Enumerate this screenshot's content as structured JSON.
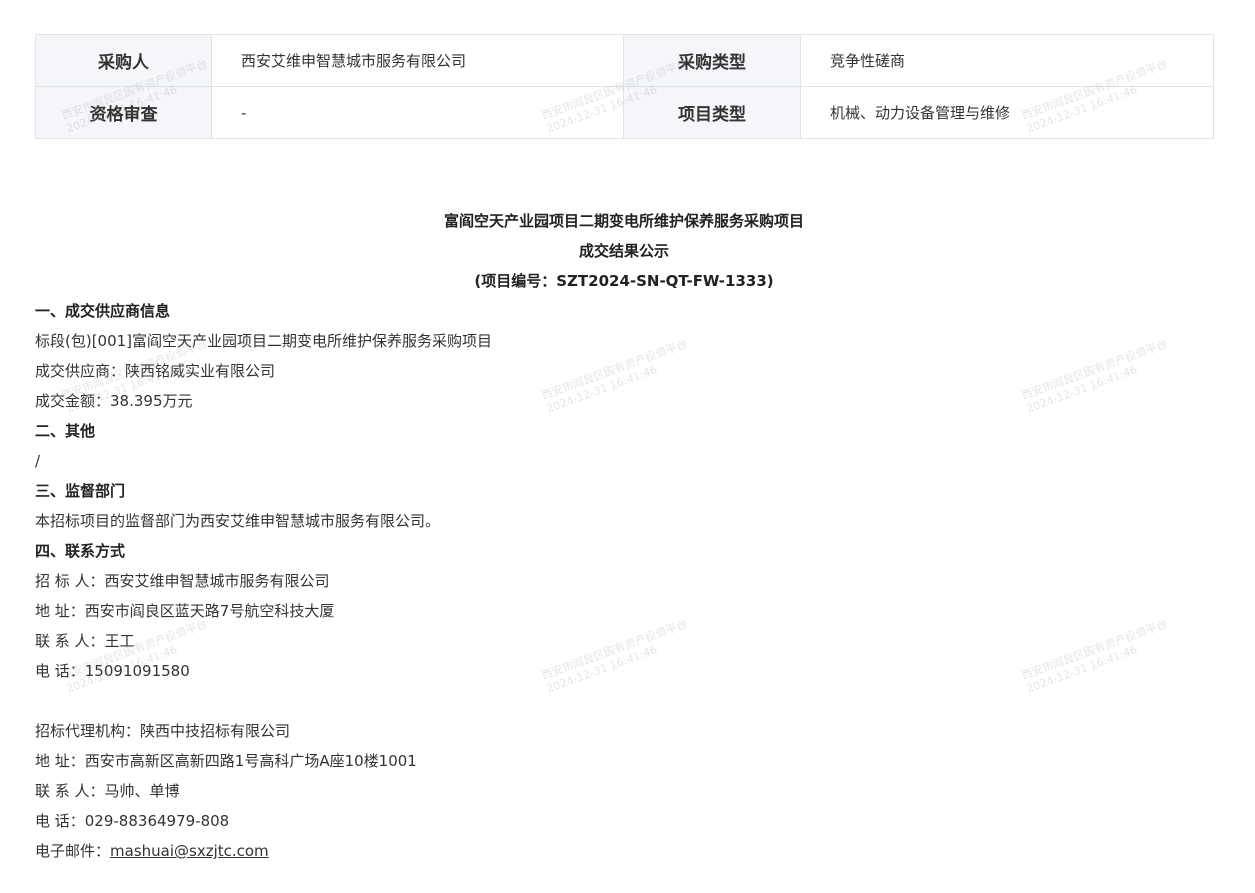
{
  "info_table": {
    "purchaser_label": "采购人",
    "purchaser_value": "西安艾维申智慧城市服务有限公司",
    "procurement_type_label": "采购类型",
    "procurement_type_value": "竞争性磋商",
    "qualification_label": "资格审查",
    "qualification_value": "-",
    "project_type_label": "项目类型",
    "project_type_value": "机械、动力设备管理与维修"
  },
  "announcement": {
    "title": "富阎空天产业园项目二期变电所维护保养服务采购项目",
    "subtitle": "成交结果公示",
    "project_number": "(项目编号：SZT2024-SN-QT-FW-1333)"
  },
  "sections": {
    "s1_heading": "一、成交供应商信息",
    "s1_lot": "标段(包)[001]富阎空天产业园项目二期变电所维护保养服务采购项目",
    "s1_supplier": "成交供应商：陕西铭威实业有限公司",
    "s1_amount": "成交金额：38.395万元",
    "s2_heading": "二、其他",
    "s2_body": "/",
    "s3_heading": "三、监督部门",
    "s3_body": "本招标项目的监督部门为西安艾维申智慧城市服务有限公司。",
    "s4_heading": "四、联系方式"
  },
  "tenderer": {
    "name": "招 标 人：西安艾维申智慧城市服务有限公司",
    "address": "地 址：西安市阎良区蓝天路7号航空科技大厦",
    "contact": "联 系 人：王工",
    "phone": "电 话：15091091580"
  },
  "agency": {
    "name": "招标代理机构：陕西中技招标有限公司",
    "address": "地 址：西安市高新区高新四路1号高科广场A座10楼1001",
    "contact": "联 系 人：马帅、单博",
    "phone": "电 话：029-88364979-808",
    "email_label": "电子邮件：",
    "email": "mashuai@sxzjtc.com"
  },
  "watermark": {
    "line1": "西安市阎良区国有资产投资平台",
    "line2": "2024-12-31 16:41:46"
  }
}
